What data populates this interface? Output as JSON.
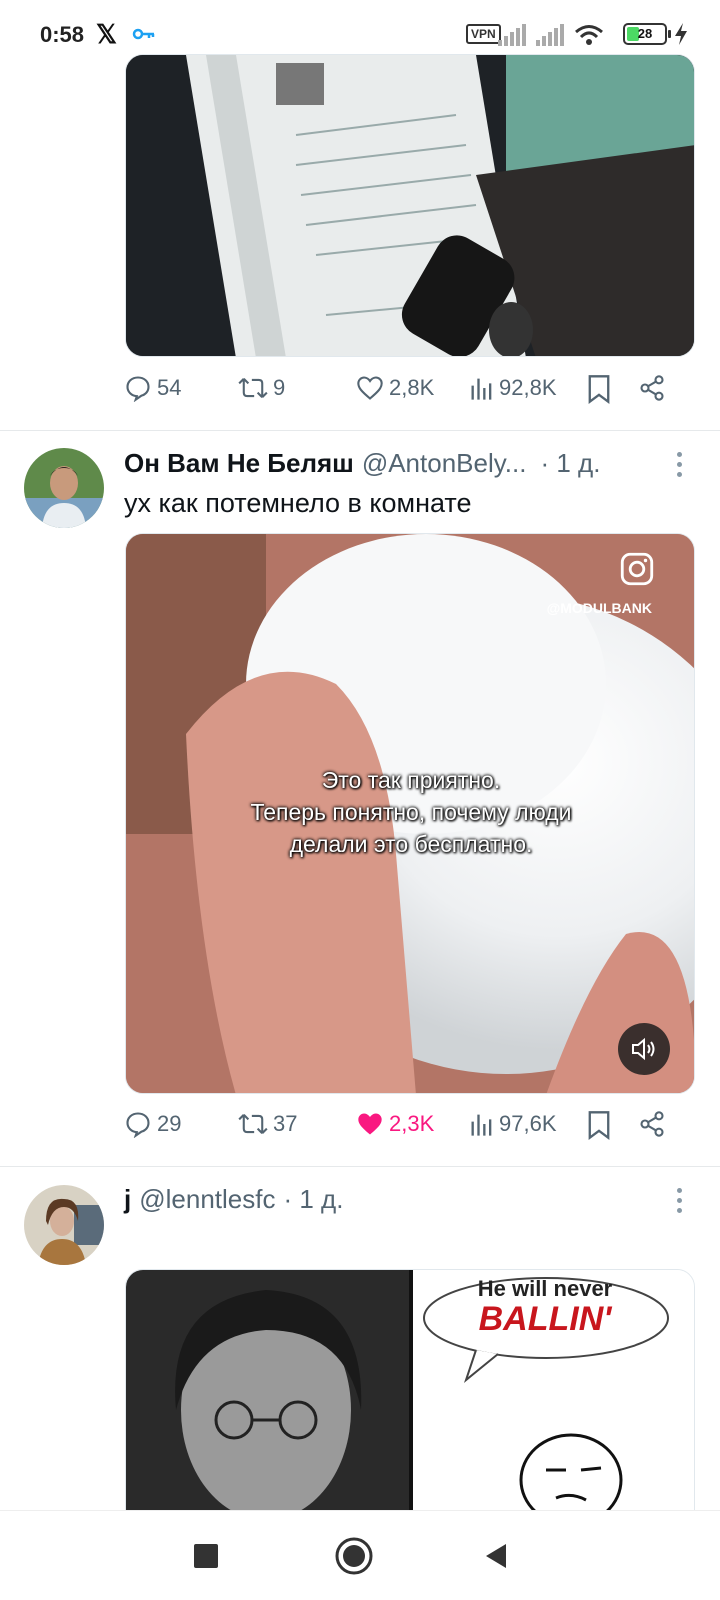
{
  "status_bar": {
    "time": "0:58",
    "vpn_label": "VPN",
    "battery_level": "28"
  },
  "tweet1": {
    "image_desc_icon": "birth-certificate-photo",
    "replies": "54",
    "retweets": "9",
    "likes": "2,8K",
    "views": "92,8K"
  },
  "tweet2": {
    "name": "Он Вам Не Беляш",
    "handle": "@AntonBely...",
    "time": "· 1 д.",
    "text": "ух как потемнело в комнате",
    "video_watermark": "@MODULBANK",
    "video_caption": [
      "Это так приятно.",
      "Теперь понятно, почему люди",
      "делали это бесплатно."
    ],
    "replies": "29",
    "retweets": "37",
    "likes": "2,3K",
    "views": "97,6K",
    "liked": true
  },
  "tweet3": {
    "name": "j",
    "handle": "@lenntlesfc",
    "time": "· 1 д.",
    "meme_bubble_line1": "He will never",
    "meme_bubble_line2": "BALLIN'"
  },
  "colors": {
    "text_secondary": "#536471",
    "like_pink": "#f91880",
    "divider": "#e6e9eb"
  }
}
